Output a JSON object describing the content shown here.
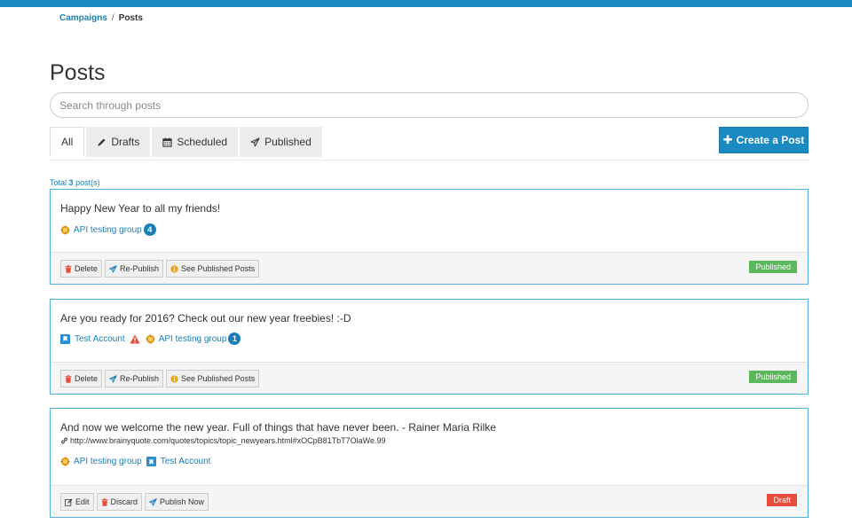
{
  "breadcrumb": {
    "parent": "Campaigns",
    "separator": "/",
    "current": "Posts"
  },
  "page_title": "Posts",
  "search": {
    "placeholder": "Search through posts",
    "value": ""
  },
  "tabs": [
    {
      "label": "All",
      "icon": "none",
      "active": true
    },
    {
      "label": "Drafts",
      "icon": "pencil-icon"
    },
    {
      "label": "Scheduled",
      "icon": "calendar-icon"
    },
    {
      "label": "Published",
      "icon": "paper-plane-icon"
    }
  ],
  "create_button": {
    "label": "Create a Post",
    "icon": "plus-icon"
  },
  "total": {
    "prefix": "Total",
    "count": "3",
    "suffix": "post(s)"
  },
  "posts": [
    {
      "text": "Happy New Year to all my friends!",
      "accounts": [
        {
          "name": "API testing group",
          "type": "group",
          "count": "4"
        }
      ],
      "actions": [
        "Delete",
        "Re-Publish",
        "See Published Posts"
      ],
      "status": "Published"
    },
    {
      "text": "Are you ready for 2016? Check out our new year freebies! :-D",
      "accounts": [
        {
          "name": "Test Account",
          "type": "page",
          "warning": true
        },
        {
          "name": "API testing group",
          "type": "group",
          "count": "1"
        }
      ],
      "actions": [
        "Delete",
        "Re-Publish",
        "See Published Posts"
      ],
      "status": "Published"
    },
    {
      "text": "And now we welcome the new year. Full of things that have never been. - Rainer Maria Rilke",
      "link": "http://www.brainyquote.com/quotes/topics/topic_newyears.html#xOCpB81TbT7OlaWe.99",
      "accounts": [
        {
          "name": "API testing group",
          "type": "group"
        },
        {
          "name": "Test Account",
          "type": "page"
        }
      ],
      "actions": [
        "Edit",
        "Discard",
        "Publish Now"
      ],
      "status": "Draft"
    }
  ],
  "colors": {
    "accent": "#1a8ac2",
    "published": "#5cb85c",
    "draft": "#e74c3c",
    "link": "#1a7fb5"
  }
}
